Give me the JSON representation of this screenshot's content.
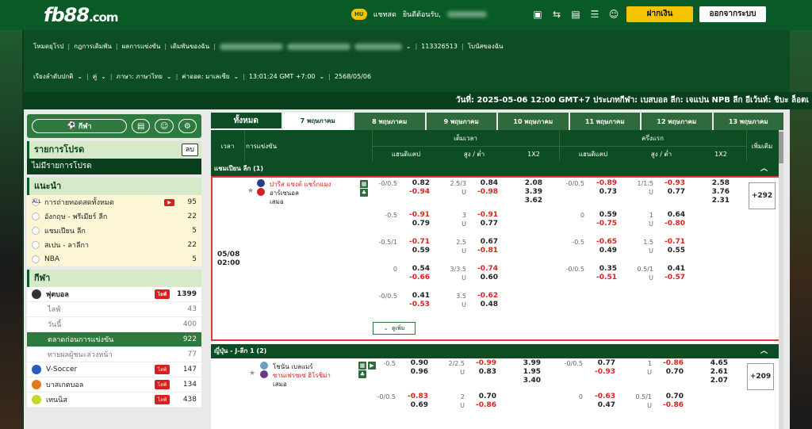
{
  "header": {
    "logo_main": "fb88",
    "logo_dot": ".com",
    "chat_label": "แชทสด",
    "welcome": "ยินดีต้อนรับ,",
    "deposit": "ฝากเงิน",
    "logout": "ออกจากระบบ",
    "icons": [
      "cashier-icon",
      "transfer-icon",
      "promo-icon",
      "history-icon",
      "profile-icon"
    ]
  },
  "nav": {
    "row1": [
      "โหมดยุโรป",
      "กฎการเดิมพัน",
      "ผลการแข่งขัน",
      "เดิมพันของฉัน",
      "113326513",
      "โบนัสของฉัน"
    ],
    "row2": [
      "เรียงลำดับปกติ",
      "คู่",
      "ภาษา: ภาษาไทย",
      "ค่าออด: มาเลเซีย",
      "13:01:24 GMT +7:00",
      "2568/05/06"
    ]
  },
  "ticker": "วันที่: 2025-05-06 12:00 GMT+7 ประเภทกีฬา: เบสบอล ลีก: เจแปน NPB ลีก อีเว้นท์: ชิบะ ล็อตเ",
  "left": {
    "sports_btn": "กีฬา",
    "fav_title": "รายการโปรด",
    "fav_del": "ลบ",
    "fav_empty": "ไม่มีรายการโปรด",
    "rec_title": "แนะนำ",
    "rec": [
      {
        "label": "การถ่ายทอดสดทั้งหมด",
        "count": "95",
        "live": true
      },
      {
        "label": "อังกฤษ - พรีเมียร์ ลีก",
        "count": "22"
      },
      {
        "label": "แชมเปียน ลีก",
        "count": "5"
      },
      {
        "label": "สเปน - ลาลีกา",
        "count": "22"
      },
      {
        "label": "NBA",
        "count": "5"
      }
    ],
    "sports_title": "กีฬา",
    "live_tag": "ไลฟ์",
    "sports": [
      {
        "label": "ฟุตบอล",
        "count": "1399",
        "live": true,
        "type": "main"
      },
      {
        "label": "ไลฟ์",
        "count": "43",
        "type": "sub"
      },
      {
        "label": "วันนี้",
        "count": "400",
        "type": "sub"
      },
      {
        "label": "ตลาดก่อนการแข่งขัน",
        "count": "922",
        "type": "sel"
      },
      {
        "label": "ทายผลผู้ชนะล่วงหน้า",
        "count": "77",
        "type": "sub"
      },
      {
        "label": "V-Soccer",
        "count": "147",
        "live": true,
        "type": "main"
      },
      {
        "label": "บาสเกตบอล",
        "count": "134",
        "live": true,
        "type": "main"
      },
      {
        "label": "เทนนิส",
        "count": "438",
        "live": true,
        "type": "main"
      }
    ]
  },
  "tabs": [
    "ทั้งหมด",
    "7 พฤษภาคม",
    "8 พฤษภาคม",
    "9 พฤษภาคม",
    "10 พฤษภาคม",
    "11 พฤษภาคม",
    "12 พฤษภาคม",
    "13 พฤษภาคม"
  ],
  "thead": {
    "time": "เวลา",
    "event": "การแข่งขัน",
    "full": "เต็มเวลา",
    "half": "ครึ่งแรก",
    "hdp": "แฮนดิแคป",
    "ou": "สูง / ต่ำ",
    "x12": "1X2",
    "more": "เพิ่มเติม"
  },
  "league1": "แชมเปียน ลีก (1)",
  "m1": {
    "home": "ปารีส แซงต์ แชร์กแมง",
    "away": "อาร์เซนอล",
    "draw": "เสมอ",
    "date": "05/08",
    "time": "02:00",
    "more": "+292",
    "more_btn": "ดูเพิ่ม",
    "rows": [
      {
        "fh": "-0/0.5",
        "fh1": "0.82",
        "fh2": "-0.94",
        "fou": "2.5/3",
        "fou1": "0.84",
        "fou2": "-0.98",
        "x1": "2.08",
        "x2": "3.39",
        "x3": "3.62",
        "hh": "-0/0.5",
        "hh1": "-0.89",
        "hh2": "0.73",
        "hou": "1/1.5",
        "hou1": "-0.93",
        "hou2": "0.77",
        "hx1": "2.58",
        "hx2": "3.76",
        "hx3": "2.31"
      },
      {
        "fh": "-0.5",
        "fh1": "-0.91",
        "fh2": "0.79",
        "fou": "3",
        "fou1": "-0.91",
        "fou2": "0.77",
        "hh": "0",
        "hh1": "0.59",
        "hh2": "-0.75",
        "hou": "1",
        "hou1": "0.64",
        "hou2": "-0.80"
      },
      {
        "fh": "-0.5/1",
        "fh1": "-0.71",
        "fh2": "0.59",
        "fou": "2.5",
        "fou1": "0.67",
        "fou2": "-0.81",
        "hh": "-0.5",
        "hh1": "-0.65",
        "hh2": "0.49",
        "hou": "1.5",
        "hou1": "-0.71",
        "hou2": "0.55"
      },
      {
        "fh": "0",
        "fh1": "0.54",
        "fh2": "-0.66",
        "fou": "3/3.5",
        "fou1": "-0.74",
        "fou2": "0.60",
        "hh": "-0/0.5",
        "hh1": "0.35",
        "hh2": "-0.51",
        "hou": "0.5/1",
        "hou1": "0.41",
        "hou2": "-0.57"
      },
      {
        "fh": "-0/0.5",
        "fh1": "0.41",
        "fh2": "-0.53",
        "fou": "3.5",
        "fou1": "-0.62",
        "fou2": "0.48"
      }
    ]
  },
  "league2": "ญี่ปุ่น - J-ลีก 1 (2)",
  "m2": {
    "home": "โชนัน เบลแมร์",
    "away": "ซานเฟรซเซ่ ฮิโรชิม่า",
    "draw": "เสมอ",
    "more": "+209",
    "rows": [
      {
        "fh": "-0.5",
        "fh1": "0.90",
        "fh2": "0.96",
        "fou": "2/2.5",
        "fou1": "-0.99",
        "fou2": "0.83",
        "x1": "3.99",
        "x2": "1.95",
        "x3": "3.40",
        "hh": "-0/0.5",
        "hh1": "0.77",
        "hh2": "-0.93",
        "hou": "1",
        "hou1": "-0.86",
        "hou2": "0.70",
        "hx1": "4.65",
        "hx2": "2.61",
        "hx3": "2.07"
      },
      {
        "fh": "-0/0.5",
        "fh1": "-0.83",
        "fh2": "0.69",
        "fou": "2",
        "fou1": "0.70",
        "fou2": "-0.86",
        "hh": "0",
        "hh1": "-0.63",
        "hh2": "0.47",
        "hou": "0.5/1",
        "hou1": "0.70",
        "hou2": "-0.86"
      }
    ]
  },
  "u_label": "U"
}
